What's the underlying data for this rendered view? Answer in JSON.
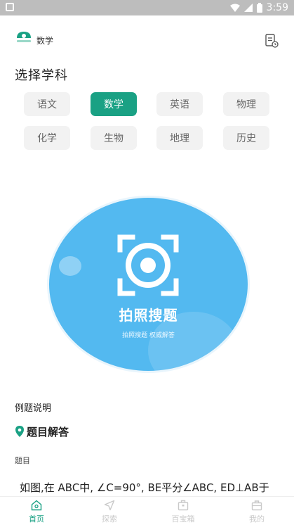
{
  "status_bar": {
    "time": "3:59"
  },
  "header": {
    "subject": "数学"
  },
  "subject_picker": {
    "title": "选择学科",
    "subjects": [
      "语文",
      "数学",
      "英语",
      "物理",
      "化学",
      "生物",
      "地理",
      "历史"
    ],
    "selected": "数学"
  },
  "scan": {
    "title": "拍照搜题",
    "subtitle": "拍照搜题 权威解答"
  },
  "example": {
    "label": "例题说明",
    "answer_title": "题目解答",
    "question_label": "题目",
    "question_text": "如图,在 ABC中, ∠C=90°, BE平分∠ABC, ED⊥AB于"
  },
  "tabs": [
    {
      "label": "首页",
      "icon": "home-icon",
      "active": true
    },
    {
      "label": "探索",
      "icon": "navigation-icon",
      "active": false
    },
    {
      "label": "百宝箱",
      "icon": "treasure-box-icon",
      "active": false
    },
    {
      "label": "我的",
      "icon": "briefcase-icon",
      "active": false
    }
  ],
  "colors": {
    "accent": "#1aa184",
    "scan_blue": "#53b9f0",
    "chip_bg": "#f2f2f2"
  }
}
